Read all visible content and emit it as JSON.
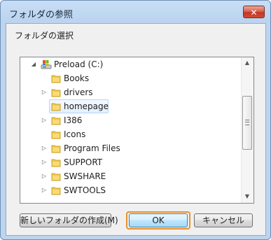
{
  "window": {
    "title": "フォルダの参照",
    "close_glyph": "✕"
  },
  "dialog": {
    "instruction": "フォルダの選択"
  },
  "tree": {
    "root_label": "Preload (C:)",
    "root_expander": "◢",
    "items": [
      {
        "label": "Books",
        "has_children": false,
        "selected": false
      },
      {
        "label": "drivers",
        "has_children": true,
        "selected": false
      },
      {
        "label": "homepage",
        "has_children": false,
        "selected": true
      },
      {
        "label": "I386",
        "has_children": true,
        "selected": false
      },
      {
        "label": "Icons",
        "has_children": false,
        "selected": false
      },
      {
        "label": "Program Files",
        "has_children": true,
        "selected": false
      },
      {
        "label": "SUPPORT",
        "has_children": true,
        "selected": false
      },
      {
        "label": "SWSHARE",
        "has_children": true,
        "selected": false
      },
      {
        "label": "SWTOOLS",
        "has_children": true,
        "selected": false
      }
    ],
    "collapsed_expander": "▷"
  },
  "scrollbar": {
    "up_arrow": "▲",
    "down_arrow": "▼"
  },
  "buttons": {
    "new_folder": "新しいフォルダの作成(M)",
    "ok": "OK",
    "cancel": "キャンセル"
  },
  "colors": {
    "folder": "#f3c947",
    "selection": "#e3efff",
    "focus_ring": "#e6912e",
    "close_button": "#c1382b"
  }
}
